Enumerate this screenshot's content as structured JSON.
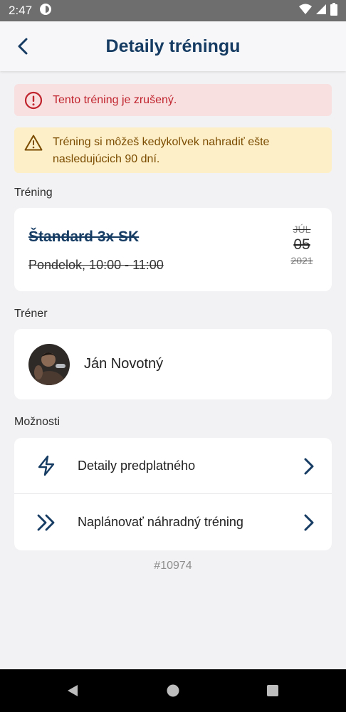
{
  "status_bar": {
    "time": "2:47"
  },
  "header": {
    "title": "Detaily tréningu"
  },
  "alerts": {
    "cancelled": "Tento tréning je zrušený.",
    "replace": "Tréning si môžeš kedykoľvek nahradiť ešte nasledujúcich 90 dní."
  },
  "training": {
    "section_label": "Tréning",
    "name": "Štandard 3x SK",
    "time": "Pondelok, 10:00 - 11:00",
    "date": {
      "month": "JÚL",
      "day": "05",
      "year": "2021"
    }
  },
  "trainer": {
    "section_label": "Tréner",
    "name": "Ján Novotný"
  },
  "options": {
    "section_label": "Možnosti",
    "items": [
      {
        "label": "Detaily predplatného",
        "icon": "lightning-icon"
      },
      {
        "label": "Naplánovať náhradný tréning",
        "icon": "double-chevron-right-icon"
      }
    ]
  },
  "id_label": "#10974",
  "colors": {
    "primary": "#163c63",
    "error_bg": "#f8dfe0",
    "error_text": "#c0242d",
    "warn_bg": "#fdf0c8",
    "warn_text": "#7b4b00"
  }
}
